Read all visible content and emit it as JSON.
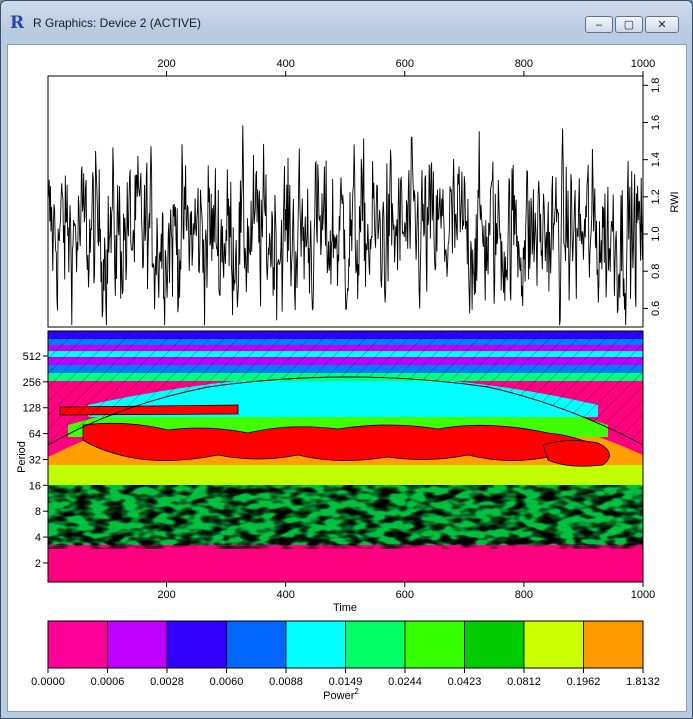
{
  "window": {
    "title": "R Graphics: Device 2 (ACTIVE)",
    "app_icon": "R",
    "buttons": {
      "minimize": "minimize-icon",
      "maximize": "maximize-icon",
      "close": "close-icon"
    }
  },
  "chart_data": [
    {
      "type": "line",
      "ylabel": "RWI",
      "xlim": [
        1,
        1000
      ],
      "ylim": [
        0.5,
        1.85
      ],
      "x_ticks": [
        "200",
        "400",
        "600",
        "800",
        "1000"
      ],
      "y_ticks": [
        "0.6",
        "0.8",
        "1.0",
        "1.2",
        "1.4",
        "1.6",
        "1.8"
      ],
      "series": [
        {
          "mean": 1.0,
          "min": 0.51,
          "max": 1.69,
          "n_points": 1000
        }
      ]
    },
    {
      "type": "heatmap",
      "xlabel": "Time",
      "ylabel": "Period",
      "x_ticks": [
        "200",
        "400",
        "600",
        "800",
        "1000"
      ],
      "y_ticks": [
        "2",
        "4",
        "8",
        "16",
        "32",
        "64",
        "128",
        "256",
        "512"
      ],
      "cone_of_influence": true,
      "colors": [
        "#ff0080",
        "#c000ff",
        "#3000ff",
        "#0080ff",
        "#00ffff",
        "#00ff80",
        "#40ff00",
        "#00c000",
        "#c0ff00",
        "#ffa000",
        "#ff0000"
      ]
    },
    {
      "type": "legend",
      "title": "Power",
      "title_superscript": "2",
      "breaks": [
        "0.0000",
        "0.0006",
        "0.0028",
        "0.0060",
        "0.0088",
        "0.0149",
        "0.0244",
        "0.0423",
        "0.0812",
        "0.1962",
        "1.8132"
      ],
      "colors": [
        "#ff0099",
        "#c000ff",
        "#3300ff",
        "#0066ff",
        "#00ffff",
        "#00ff66",
        "#33ff00",
        "#00cc00",
        "#ccff00",
        "#ff9900",
        "#ff0000"
      ]
    }
  ]
}
